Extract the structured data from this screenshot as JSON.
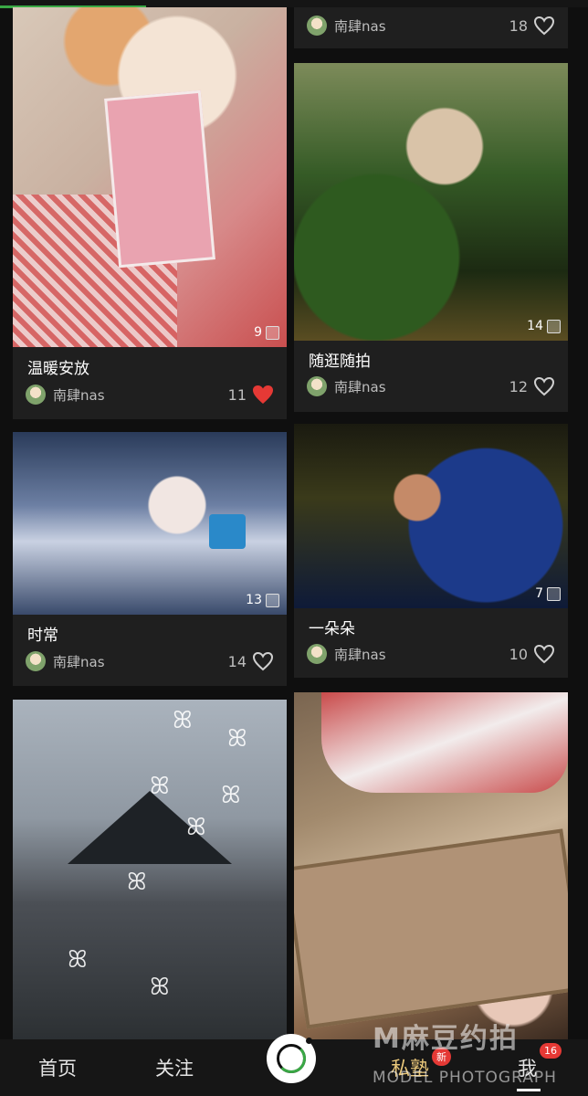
{
  "feed": {
    "cards": [
      {
        "id": "c1",
        "title": "温暖安放",
        "author": "南肆nas",
        "likes": "11",
        "liked": true,
        "photo_count": "9"
      },
      {
        "id": "c2",
        "title": "",
        "author": "南肆nas",
        "likes": "18",
        "liked": false,
        "photo_count": ""
      },
      {
        "id": "c3",
        "title": "随逛随拍",
        "author": "南肆nas",
        "likes": "12",
        "liked": false,
        "photo_count": "14"
      },
      {
        "id": "c4",
        "title": "时常",
        "author": "南肆nas",
        "likes": "14",
        "liked": false,
        "photo_count": "13"
      },
      {
        "id": "c5",
        "title": "一朵朵",
        "author": "南肆nas",
        "likes": "10",
        "liked": false,
        "photo_count": "7"
      }
    ]
  },
  "nav": {
    "home": "首页",
    "follow": "关注",
    "private": "私塾",
    "private_badge": "新",
    "me": "我",
    "me_badge": "16"
  },
  "watermark": {
    "brand": "M麻豆约拍",
    "tagline": "MODEL PHOTOGRAPH"
  },
  "colors": {
    "accent": "#3aa845",
    "like": "#e53935",
    "background": "#0f0f0f"
  }
}
